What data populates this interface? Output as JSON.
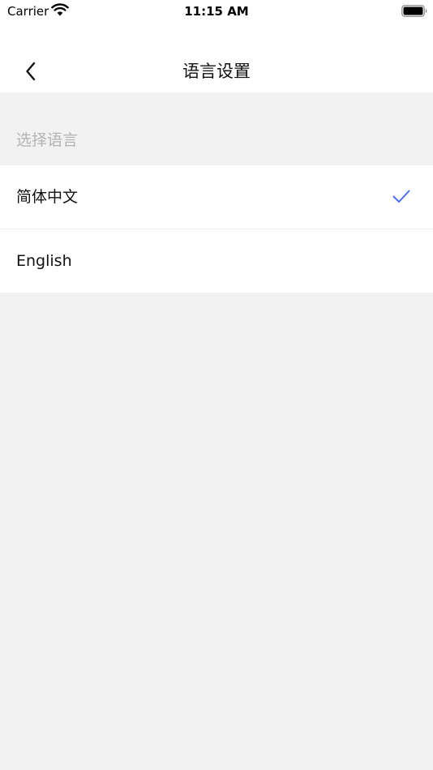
{
  "status_bar": {
    "carrier": "Carrier",
    "time": "11:15 AM",
    "wifi_icon": "wifi-icon",
    "battery_icon": "battery-full-icon"
  },
  "nav": {
    "title": "语言设置",
    "back_icon": "chevron-left-icon"
  },
  "section": {
    "label": "选择语言"
  },
  "languages": [
    {
      "label": "简体中文",
      "selected": true
    },
    {
      "label": "English",
      "selected": false
    }
  ],
  "colors": {
    "accent": "#4a6ff0",
    "background": "#f2f2f2",
    "surface": "#ffffff",
    "section_text": "#b3b3b3"
  }
}
